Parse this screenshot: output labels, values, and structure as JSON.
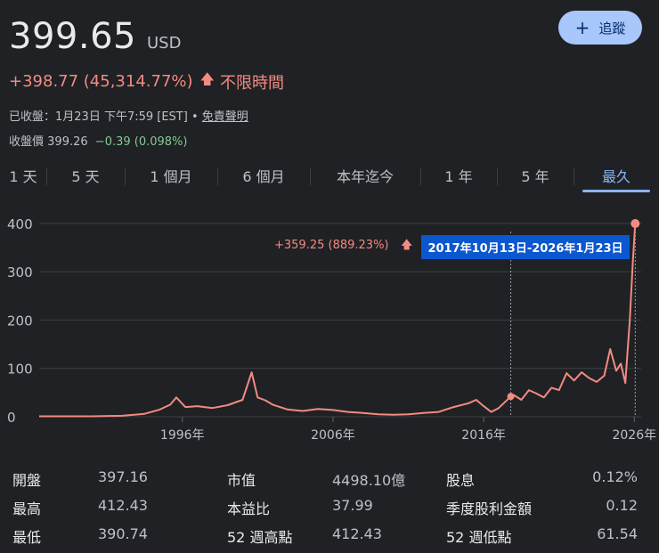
{
  "quote": {
    "price": "399.65",
    "currency": "USD",
    "change": "+398.77 (45,314.77%)",
    "period": "不限時間",
    "meta_prefix": "已收盤：1月23日 下午7:59 [EST] •",
    "disclaimer": "免責聲明",
    "close_label": "收盤價",
    "close_price": "399.26",
    "close_change": "−0.39 (0.098%)"
  },
  "follow_button": {
    "label": "追蹤"
  },
  "tabs": [
    "1 天",
    "5 天",
    "1 個月",
    "6 個月",
    "本年迄今",
    "1 年",
    "5 年",
    "最久"
  ],
  "active_tab": "最久",
  "tooltip": {
    "change": "+359.25 (889.23%)",
    "range": "2017年10月13日-2026年1月23日"
  },
  "chart_data": {
    "type": "line",
    "y_ticks": [
      0,
      100,
      200,
      300,
      400
    ],
    "x_ticks": [
      "1996年",
      "2006年",
      "2016年",
      "2026年"
    ],
    "ylim": [
      0,
      420
    ],
    "xlim": [
      1986.5,
      2026.1
    ],
    "grid": true,
    "series": [
      {
        "color": "#f28b82",
        "x": [
          1986.5,
          1990,
          1992,
          1993.5,
          1994.5,
          1995.2,
          1995.6,
          1996.2,
          1997,
          1998,
          1999,
          2000,
          2000.6,
          2001,
          2001.5,
          2002,
          2003,
          2004,
          2005,
          2006,
          2007,
          2008,
          2009,
          2010,
          2011,
          2012,
          2013,
          2014,
          2015,
          2015.5,
          2016,
          2016.5,
          2017,
          2017.8,
          2018,
          2018.5,
          2019,
          2019.5,
          2020,
          2020.5,
          2021,
          2021.5,
          2022,
          2022.5,
          2023,
          2023.5,
          2024,
          2024.4,
          2024.8,
          2025.1,
          2025.4,
          2025.7,
          2025.9,
          2026.06
        ],
        "y": [
          1,
          1,
          2,
          6,
          15,
          25,
          40,
          20,
          22,
          18,
          24,
          35,
          92,
          40,
          34,
          25,
          15,
          12,
          16,
          14,
          10,
          8,
          5,
          4,
          5,
          8,
          10,
          20,
          28,
          35,
          22,
          10,
          18,
          42,
          45,
          35,
          55,
          48,
          40,
          60,
          55,
          90,
          75,
          92,
          80,
          72,
          85,
          140,
          95,
          110,
          70,
          200,
          320,
          399.65
        ]
      }
    ]
  },
  "stats": [
    [
      {
        "label": "開盤",
        "value": "397.16"
      },
      {
        "label": "市值",
        "value": "4498.10億"
      },
      {
        "label": "股息",
        "value": "0.12%"
      }
    ],
    [
      {
        "label": "最高",
        "value": "412.43"
      },
      {
        "label": "本益比",
        "value": "37.99"
      },
      {
        "label": "季度股利金額",
        "value": "0.12"
      }
    ],
    [
      {
        "label": "最低",
        "value": "390.74"
      },
      {
        "label": "52 週高點",
        "value": "412.43"
      },
      {
        "label": "52 週低點",
        "value": "61.54"
      }
    ]
  ]
}
